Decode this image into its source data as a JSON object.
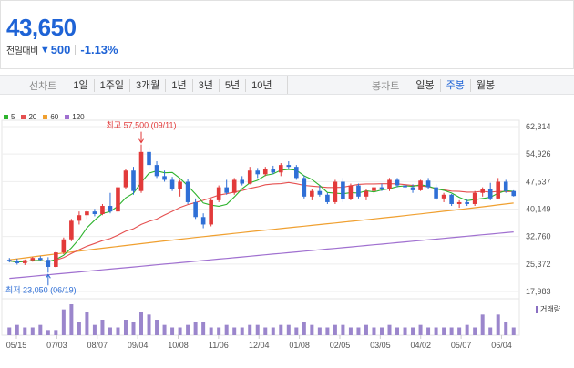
{
  "quote": {
    "price": "43,650",
    "change_label": "전일대비",
    "change_dir": "▼",
    "change": "500",
    "change_pct": "-1.13%"
  },
  "toolbar": {
    "line_label": "선차트",
    "line_items": [
      "1일",
      "1주일",
      "3개월",
      "1년",
      "3년",
      "5년",
      "10년"
    ],
    "candle_label": "봉차트",
    "candle_items": [
      "일봉",
      "주봉",
      "월봉"
    ],
    "active_candle": "주봉"
  },
  "chart_data": {
    "type": "candlestick",
    "legend": [
      {
        "name": "5",
        "color": "#2db32d"
      },
      {
        "name": "20",
        "color": "#e55050"
      },
      {
        "name": "60",
        "color": "#f0a030"
      },
      {
        "name": "120",
        "color": "#a070d0"
      }
    ],
    "y_ticks": [
      "62,314",
      "54,926",
      "47,537",
      "40,149",
      "32,760",
      "25,372",
      "17,983"
    ],
    "ylim": [
      17983,
      62314
    ],
    "x_ticks": [
      "05/15",
      "07/03",
      "08/07",
      "09/04",
      "10/08",
      "11/06",
      "12/04",
      "01/08",
      "02/05",
      "03/05",
      "04/02",
      "05/07",
      "06/04"
    ],
    "annotations": {
      "high": "최고 57,500 (09/11)",
      "low": "최저 23,050 (06/19)"
    },
    "volume_label": "거래량",
    "candles": [
      [
        26500,
        27000,
        25800,
        26200
      ],
      [
        26200,
        26800,
        25200,
        25600
      ],
      [
        25600,
        26600,
        25100,
        26400
      ],
      [
        26400,
        27300,
        26000,
        27000
      ],
      [
        27000,
        27500,
        26200,
        26500
      ],
      [
        26500,
        27200,
        23050,
        24600
      ],
      [
        24600,
        28800,
        24400,
        28500
      ],
      [
        28500,
        32500,
        28000,
        32000
      ],
      [
        32000,
        37500,
        31500,
        37000
      ],
      [
        37000,
        39500,
        36000,
        38500
      ],
      [
        38500,
        40000,
        37500,
        39500
      ],
      [
        39500,
        40200,
        38200,
        38800
      ],
      [
        38800,
        41500,
        38500,
        41000
      ],
      [
        41000,
        44500,
        39000,
        39500
      ],
      [
        39500,
        46500,
        39000,
        46000
      ],
      [
        46000,
        51000,
        45500,
        50500
      ],
      [
        50500,
        51500,
        44000,
        45000
      ],
      [
        45000,
        57500,
        44500,
        55500
      ],
      [
        55500,
        56500,
        51000,
        52000
      ],
      [
        52000,
        53000,
        48500,
        49000
      ],
      [
        49000,
        50500,
        47500,
        48000
      ],
      [
        48000,
        48800,
        45000,
        45500
      ],
      [
        45500,
        48000,
        43500,
        47500
      ],
      [
        47500,
        48200,
        41500,
        42000
      ],
      [
        42000,
        43000,
        37500,
        38000
      ],
      [
        38000,
        39000,
        35000,
        36000
      ],
      [
        36000,
        43000,
        35500,
        42500
      ],
      [
        42500,
        46500,
        42000,
        46000
      ],
      [
        46000,
        48000,
        44000,
        44500
      ],
      [
        44500,
        48500,
        44000,
        48000
      ],
      [
        48000,
        49000,
        46500,
        47000
      ],
      [
        47000,
        51500,
        46800,
        50500
      ],
      [
        50500,
        51200,
        48500,
        49500
      ],
      [
        49500,
        51500,
        49000,
        51000
      ],
      [
        51000,
        51800,
        49500,
        50000
      ],
      [
        50000,
        52500,
        49000,
        52000
      ],
      [
        52000,
        53000,
        51000,
        51500
      ],
      [
        51500,
        52000,
        48000,
        48500
      ],
      [
        48500,
        49200,
        43000,
        43500
      ],
      [
        43500,
        45500,
        42500,
        45000
      ],
      [
        45000,
        46500,
        43500,
        44000
      ],
      [
        44000,
        44500,
        41500,
        42000
      ],
      [
        42000,
        48000,
        41500,
        47500
      ],
      [
        47500,
        48500,
        42000,
        42800
      ],
      [
        42800,
        47000,
        42500,
        46500
      ],
      [
        46500,
        47000,
        43000,
        43500
      ],
      [
        43500,
        45500,
        42500,
        45000
      ],
      [
        45000,
        46500,
        44000,
        46000
      ],
      [
        46000,
        47000,
        45000,
        45500
      ],
      [
        45500,
        48500,
        45000,
        48000
      ],
      [
        48000,
        48500,
        46000,
        46500
      ],
      [
        46500,
        47000,
        45500,
        46000
      ],
      [
        46000,
        46800,
        44500,
        45200
      ],
      [
        45200,
        48000,
        45000,
        47800
      ],
      [
        47800,
        48500,
        45500,
        46000
      ],
      [
        46000,
        46800,
        42500,
        43000
      ],
      [
        43000,
        44500,
        42000,
        44000
      ],
      [
        44000,
        44200,
        41000,
        41500
      ],
      [
        41500,
        42500,
        40500,
        42000
      ],
      [
        42000,
        42800,
        41000,
        41500
      ],
      [
        41500,
        45000,
        41000,
        44500
      ],
      [
        44500,
        46000,
        43500,
        45500
      ],
      [
        45500,
        47200,
        42500,
        43000
      ],
      [
        43000,
        48500,
        42800,
        47500
      ],
      [
        47500,
        48000,
        44500,
        45000
      ],
      [
        45000,
        45200,
        43500,
        43650
      ]
    ],
    "volume": [
      3,
      4,
      3,
      3,
      4,
      2,
      2,
      10,
      12,
      5,
      9,
      4,
      6,
      3,
      3,
      6,
      5,
      9,
      8,
      6,
      4,
      3,
      3,
      4,
      5,
      5,
      3,
      3,
      4,
      3,
      3,
      4,
      4,
      3,
      3,
      4,
      4,
      3,
      5,
      4,
      3,
      3,
      4,
      4,
      3,
      3,
      4,
      3,
      3,
      4,
      3,
      3,
      3,
      4,
      3,
      3,
      3,
      3,
      3,
      4,
      3,
      8,
      3,
      8,
      5,
      3
    ]
  }
}
